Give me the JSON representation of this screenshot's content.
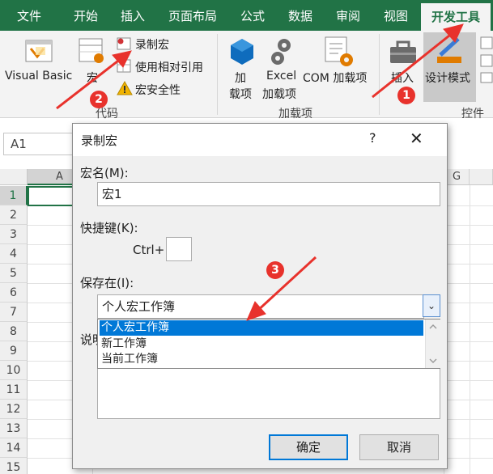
{
  "ribbon_tabs": [
    "文件",
    "开始",
    "插入",
    "页面布局",
    "公式",
    "数据",
    "审阅",
    "视图",
    "开发工具"
  ],
  "ribbon": {
    "visual_basic": "Visual Basic",
    "macros": "宏",
    "record_macro": "录制宏",
    "relative_ref": "使用相对引用",
    "macro_security": "宏安全性",
    "group_code": "代码",
    "addins_line1": "加",
    "addins_line2": "载项",
    "excel_addins_line1": "Excel",
    "excel_addins_line2": "加载项",
    "com_addins": "COM 加载项",
    "group_addins": "加载项",
    "insert": "插入",
    "design_mode": "设计模式",
    "group_controls": "控件"
  },
  "name_box": "A1",
  "columns": [
    "A",
    "G"
  ],
  "rows": [
    "1",
    "2",
    "3",
    "4",
    "5",
    "6",
    "7",
    "8",
    "9",
    "10",
    "11",
    "12",
    "13",
    "14",
    "15"
  ],
  "dialog": {
    "title": "录制宏",
    "help": "?",
    "close": "✕",
    "macro_name_label": "宏名(M):",
    "macro_name_value": "宏1",
    "shortcut_label": "快捷键(K):",
    "shortcut_prefix": "Ctrl+",
    "store_in_label": "保存在(I):",
    "store_in_value": "个人宏工作簿",
    "store_options": [
      "个人宏工作簿",
      "新工作簿",
      "当前工作簿"
    ],
    "description_label": "说明",
    "ok": "确定",
    "cancel": "取消"
  },
  "annotations": [
    "1",
    "2",
    "3"
  ],
  "colors": {
    "excel_green": "#217346",
    "annotation_red": "#e8322c",
    "highlight_blue": "#0078d7"
  }
}
